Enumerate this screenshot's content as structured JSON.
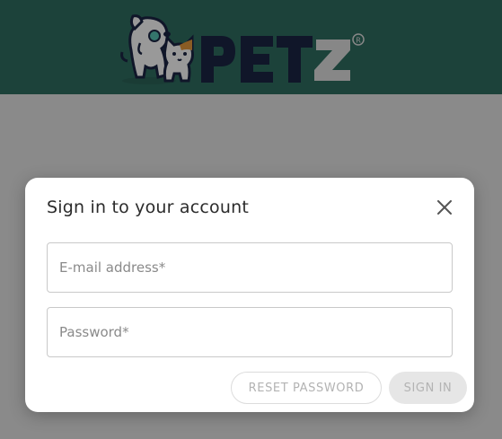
{
  "header": {
    "brand": "PETZ",
    "trademark": "®",
    "colors": {
      "background": "#2f6f62",
      "logo_text": "#1b2545",
      "logo_z": "#e2e2e2"
    }
  },
  "modal": {
    "title": "Sign in to your account",
    "email_field": {
      "placeholder": "E-mail address*",
      "value": ""
    },
    "password_field": {
      "placeholder": "Password*",
      "value": ""
    },
    "reset_button_label": "RESET PASSWORD",
    "signin_button_label": "SIGN IN",
    "close_icon": "close-icon"
  },
  "colors": {
    "overlay": "rgba(0,0,0,0.40)",
    "button_disabled_text": "#b3b3b3",
    "signin_button_bg": "#e6e6e6"
  }
}
